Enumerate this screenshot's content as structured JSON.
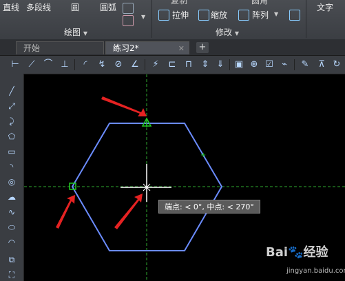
{
  "ribbon": {
    "draw_panel": {
      "title": "绘图",
      "items": [
        "直线",
        "多段线",
        "圆",
        "圆弧"
      ]
    },
    "modify_panel": {
      "title": "修改",
      "items": [
        "拉伸",
        "缩放",
        "阵列"
      ],
      "cut_top_labels": [
        "复制",
        "圆角"
      ]
    },
    "annotation_panel": {
      "item": "文字"
    }
  },
  "tabs": [
    {
      "label": "开始",
      "active": false
    },
    {
      "label": "练习2*",
      "active": true
    }
  ],
  "tab_close": "✕",
  "tab_plus": "+",
  "tooltip": "端点: < 0°,  中点: < 270°",
  "watermark": {
    "brand": "Bai",
    "brand_tail": "经验",
    "site": "jingyan.baidu.com"
  },
  "colors": {
    "hexagon": "#6b8cff",
    "crosshair_tracking": "#2faa2f",
    "arrow": "#e52222",
    "canvas_bg": "#000000"
  }
}
